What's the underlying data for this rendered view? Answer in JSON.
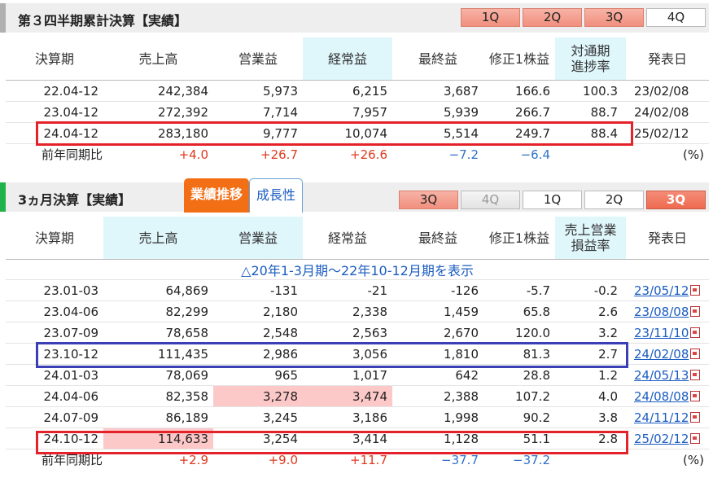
{
  "section1": {
    "title": "第３四半期累計決算【実績】",
    "tabs": [
      "1Q",
      "2Q",
      "3Q",
      "4Q"
    ],
    "headers": [
      "決算期",
      "売上高",
      "営業益",
      "経常益",
      "最終益",
      "修正1株益",
      "対通期\n進捗率",
      "発表日"
    ],
    "rows": [
      {
        "period": "22.04-12",
        "sales": "242,384",
        "op": "5,973",
        "ord": "6,215",
        "net": "3,687",
        "eps": "166.6",
        "rate": "100.3",
        "date": "23/02/08"
      },
      {
        "period": "23.04-12",
        "sales": "272,392",
        "op": "7,714",
        "ord": "7,957",
        "net": "5,939",
        "eps": "266.7",
        "rate": "88.7",
        "date": "24/02/08"
      },
      {
        "period": "24.04-12",
        "sales": "283,180",
        "op": "9,777",
        "ord": "10,074",
        "net": "5,514",
        "eps": "249.7",
        "rate": "88.4",
        "date": "25/02/12"
      }
    ],
    "yoy": {
      "label": "前年同期比",
      "sales": "+4.0",
      "op": "+26.7",
      "ord": "+26.6",
      "net": "−7.2",
      "eps": "−6.4",
      "unit": "(%)"
    }
  },
  "section2": {
    "title": "3ヵ月決算【実績】",
    "subtabs": [
      "業績推移",
      "成長性"
    ],
    "tabs": [
      "3Q",
      "4Q",
      "1Q",
      "2Q",
      "3Q"
    ],
    "headers": [
      "決算期",
      "売上高",
      "営業益",
      "経常益",
      "最終益",
      "修正1株益",
      "売上営業\n損益率",
      "発表日"
    ],
    "toggle": "△20年1-3月期～22年10-12月期を表示",
    "rows": [
      {
        "period": "23.01-03",
        "sales": "64,869",
        "op": "-131",
        "ord": "-21",
        "net": "-126",
        "eps": "-5.7",
        "rate": "-0.2",
        "date": "23/05/12"
      },
      {
        "period": "23.04-06",
        "sales": "82,299",
        "op": "2,180",
        "ord": "2,338",
        "net": "1,459",
        "eps": "65.8",
        "rate": "2.6",
        "date": "23/08/08"
      },
      {
        "period": "23.07-09",
        "sales": "78,658",
        "op": "2,548",
        "ord": "2,563",
        "net": "2,670",
        "eps": "120.0",
        "rate": "3.2",
        "date": "23/11/10"
      },
      {
        "period": "23.10-12",
        "sales": "111,435",
        "op": "2,986",
        "ord": "3,056",
        "net": "1,810",
        "eps": "81.3",
        "rate": "2.7",
        "date": "24/02/08"
      },
      {
        "period": "24.01-03",
        "sales": "78,069",
        "op": "965",
        "ord": "1,017",
        "net": "642",
        "eps": "28.8",
        "rate": "1.2",
        "date": "24/05/13"
      },
      {
        "period": "24.04-06",
        "sales": "82,358",
        "op": "3,278",
        "ord": "3,474",
        "net": "2,388",
        "eps": "107.2",
        "rate": "4.0",
        "date": "24/08/08"
      },
      {
        "period": "24.07-09",
        "sales": "86,189",
        "op": "3,245",
        "ord": "3,186",
        "net": "1,998",
        "eps": "90.2",
        "rate": "3.8",
        "date": "24/11/12"
      },
      {
        "period": "24.10-12",
        "sales": "114,633",
        "op": "3,254",
        "ord": "3,414",
        "net": "1,128",
        "eps": "51.1",
        "rate": "2.8",
        "date": "25/02/12"
      }
    ],
    "yoy": {
      "label": "前年同期比",
      "sales": "+2.9",
      "op": "+9.0",
      "ord": "+11.7",
      "net": "−37.7",
      "eps": "−37.2",
      "unit": "(%)"
    }
  },
  "colors": {
    "title_bar_1": "#b0b0b0",
    "title_bar_2": "#22b24c",
    "positive": "#e0391d",
    "negative": "#2f72c8",
    "highlight_header": "#dff6fb",
    "pink_cell": "#fcc8c8"
  }
}
